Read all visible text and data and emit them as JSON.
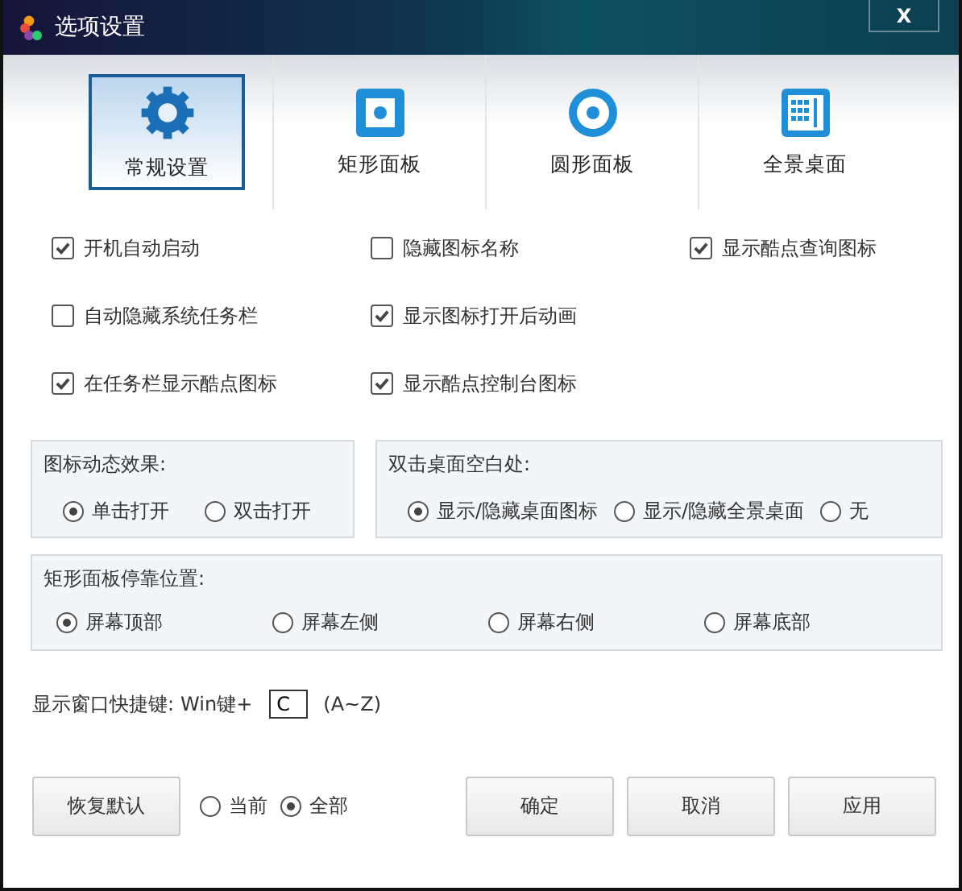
{
  "window": {
    "title": "选项设置",
    "close": "X"
  },
  "tabs": [
    {
      "label": "常规设置",
      "kind": "gear",
      "selected": true
    },
    {
      "label": "矩形面板",
      "kind": "square",
      "selected": false
    },
    {
      "label": "圆形面板",
      "kind": "circle",
      "selected": false
    },
    {
      "label": "全景桌面",
      "kind": "grid",
      "selected": false
    }
  ],
  "checkboxes": [
    [
      {
        "label": "开机自动启动",
        "checked": true
      },
      {
        "label": "隐藏图标名称",
        "checked": false
      },
      {
        "label": "显示酷点查询图标",
        "checked": true
      }
    ],
    [
      {
        "label": "自动隐藏系统任务栏",
        "checked": false
      },
      {
        "label": "显示图标打开后动画",
        "checked": true
      }
    ],
    [
      {
        "label": "在任务栏显示酷点图标",
        "checked": true
      },
      {
        "label": "显示酷点控制台图标",
        "checked": true
      }
    ]
  ],
  "groups": [
    {
      "title": "图标动态效果:",
      "options": [
        {
          "label": "单击打开",
          "selected": true
        },
        {
          "label": "双击打开",
          "selected": false
        }
      ]
    },
    {
      "title": "双击桌面空白处:",
      "options": [
        {
          "label": "显示/隐藏桌面图标",
          "selected": true
        },
        {
          "label": "显示/隐藏全景桌面",
          "selected": false
        },
        {
          "label": "无",
          "selected": false
        }
      ]
    },
    {
      "title": "矩形面板停靠位置:",
      "options": [
        {
          "label": "屏幕顶部",
          "selected": true
        },
        {
          "label": "屏幕左侧",
          "selected": false
        },
        {
          "label": "屏幕右侧",
          "selected": false
        },
        {
          "label": "屏幕底部",
          "selected": false
        }
      ]
    }
  ],
  "shortcut": {
    "label": "显示窗口快捷键:",
    "prefix": "Win键+",
    "value": "C",
    "range": "(A~Z)"
  },
  "reset": {
    "label": "恢复默认",
    "options": [
      {
        "label": "当前",
        "selected": false
      },
      {
        "label": "全部",
        "selected": true
      }
    ]
  },
  "buttons": [
    "确定",
    "取消",
    "应用"
  ]
}
